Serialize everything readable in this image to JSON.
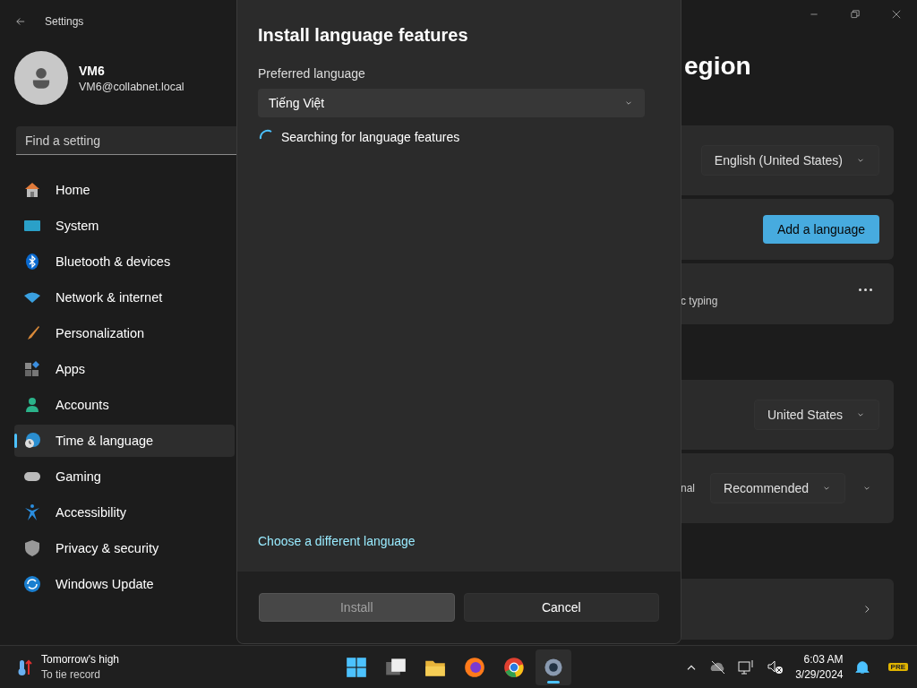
{
  "window": {
    "title": "Settings"
  },
  "user": {
    "name": "VM6",
    "email": "VM6@collabnet.local"
  },
  "search": {
    "placeholder": "Find a setting"
  },
  "sidebar": {
    "items": [
      {
        "label": "Home",
        "selected": false
      },
      {
        "label": "System",
        "selected": false
      },
      {
        "label": "Bluetooth & devices",
        "selected": false
      },
      {
        "label": "Network & internet",
        "selected": false
      },
      {
        "label": "Personalization",
        "selected": false
      },
      {
        "label": "Apps",
        "selected": false
      },
      {
        "label": "Accounts",
        "selected": false
      },
      {
        "label": "Time & language",
        "selected": true
      },
      {
        "label": "Gaming",
        "selected": false
      },
      {
        "label": "Accessibility",
        "selected": false
      },
      {
        "label": "Privacy & security",
        "selected": false
      },
      {
        "label": "Windows Update",
        "selected": false
      }
    ]
  },
  "page": {
    "title": "egion",
    "cards": [
      {
        "kind": "dropdown",
        "value": "English (United States)"
      },
      {
        "kind": "button",
        "label": "Add a language"
      },
      {
        "kind": "more",
        "fragment": "c typing"
      },
      {
        "kind": "dropdown",
        "value": "United States",
        "gap": true
      },
      {
        "kind": "dropdown_expand",
        "fragment": "nal",
        "value": "Recommended"
      },
      {
        "kind": "link",
        "gap": true
      }
    ]
  },
  "dialog": {
    "title": "Install language features",
    "field_label": "Preferred language",
    "select": {
      "value": "Tiếng Việt"
    },
    "status": "Searching for language features",
    "link": "Choose a different language",
    "buttons": [
      {
        "label": "Install",
        "disabled": true
      },
      {
        "label": "Cancel",
        "disabled": false
      }
    ]
  },
  "taskbar": {
    "weather": {
      "title": "Tomorrow's high",
      "subtitle": "To tie record"
    },
    "apps": [
      {
        "selected": false
      },
      {
        "selected": false
      },
      {
        "selected": false
      },
      {
        "selected": false
      },
      {
        "selected": false
      },
      {
        "selected": true
      }
    ],
    "time": "6:03 AM",
    "date": "3/29/2024",
    "badge": "PRE"
  }
}
